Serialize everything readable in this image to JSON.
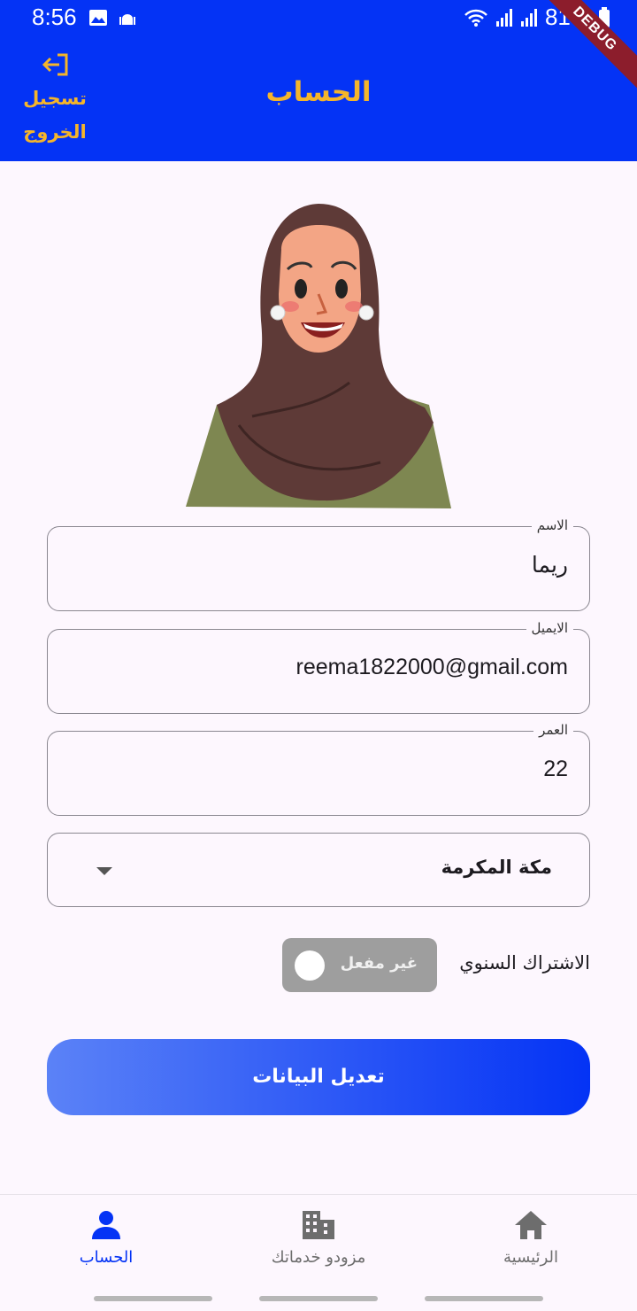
{
  "status_bar": {
    "time": "8:56",
    "battery_percent": "81%"
  },
  "debug_banner": "DEBUG",
  "app_bar": {
    "title": "الحساب",
    "logout_label_line1": "تسجيل",
    "logout_label_line2": "الخروج"
  },
  "form": {
    "name": {
      "label": "الاسم",
      "value": "ريما"
    },
    "email": {
      "label": "الايميل",
      "value": "reema1822000@gmail.com"
    },
    "age": {
      "label": "العمر",
      "value": "22"
    },
    "city": {
      "selected": "مكة المكرمة"
    }
  },
  "subscription": {
    "label": "الاشتراك السنوي",
    "toggle_text": "غير مفعل",
    "enabled": false
  },
  "primary_button": {
    "label": "تعديل البيانات"
  },
  "bottom_nav": {
    "items": [
      {
        "label": "الرئيسية",
        "icon": "home-icon",
        "active": false
      },
      {
        "label": "مزودو خدماتك",
        "icon": "building-icon",
        "active": false
      },
      {
        "label": "الحساب",
        "icon": "person-icon",
        "active": true
      }
    ]
  },
  "colors": {
    "primary": "#0433f5",
    "accent": "#f5b52a",
    "toggle_off": "#9e9e9e"
  }
}
